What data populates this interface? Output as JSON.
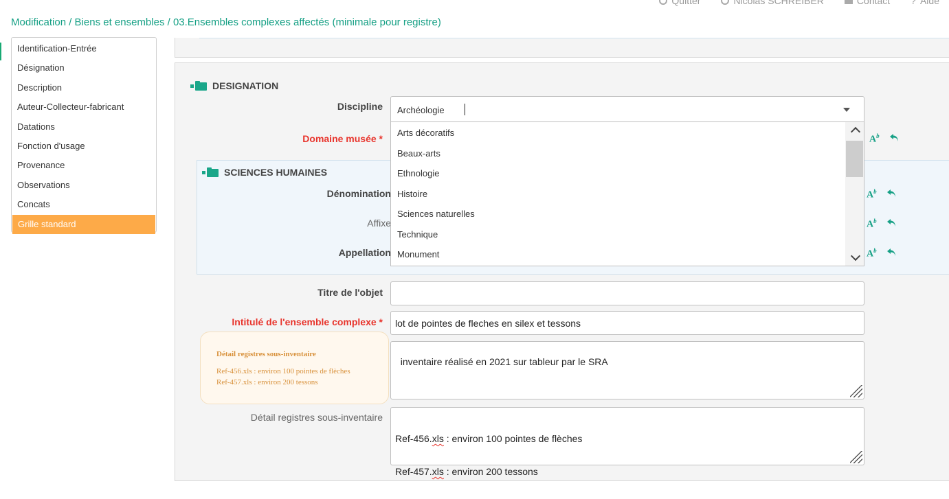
{
  "topnav": {
    "quit_label": "Quitter",
    "user_label": "Nicolas SCHREIBER",
    "contact_label": "Contact",
    "help_label": "Aide"
  },
  "breadcrumb": {
    "text": "Modification / Biens et ensembles / 03.Ensembles complexes affectés (minimale pour registre)"
  },
  "sidebar": {
    "items": [
      {
        "label": "Identification-Entrée"
      },
      {
        "label": "Désignation"
      },
      {
        "label": "Description"
      },
      {
        "label": "Auteur-Collecteur-fabricant"
      },
      {
        "label": "Datations"
      },
      {
        "label": "Fonction d'usage"
      },
      {
        "label": "Provenance"
      },
      {
        "label": "Observations"
      },
      {
        "label": "Concats"
      },
      {
        "label": "Grille standard"
      }
    ],
    "active_index": 9
  },
  "designation": {
    "section_title": "DESIGNATION",
    "discipline_label": "Discipline",
    "discipline_value": "Archéologie",
    "discipline_options": [
      "Arts décoratifs",
      "Beaux-arts",
      "Ethnologie",
      "Histoire",
      "Sciences naturelles",
      "Technique",
      "Monument"
    ],
    "domaine_label": "Domaine musée *",
    "sciences_title": "SCIENCES HUMAINES",
    "denomination_label": "Dénomination",
    "affixe_label": "Affixe",
    "appellation_label": "Appellation",
    "titre_label": "Titre de l'objet",
    "titre_value": "",
    "intitule_label": "Intitulé de l'ensemble complexe *",
    "intitule_value": "lot de pointes de fleches en silex et tessons",
    "notes_value": "inventaire réalisé en 2021 sur tableur par le SRA",
    "info_box": {
      "title": "Détail registres sous-inventaire",
      "line1": "Ref-456.xls : environ 100 pointes de flèches",
      "line2": "Ref-457.xls : environ 200 tessons"
    },
    "detail_label": "Détail registres sous-inventaire",
    "detail_lines": [
      {
        "prefix": "Ref-456.",
        "ext": "xls",
        "suffix": " : environ 100 pointes de flèches"
      },
      {
        "prefix": "Ref-457.",
        "ext": "xls",
        "suffix": " : environ 200 tessons"
      }
    ]
  },
  "colors": {
    "accent": "#16a085",
    "required": "#e8342c",
    "active_tab": "#fdaa48",
    "info_text": "#d8913b"
  }
}
